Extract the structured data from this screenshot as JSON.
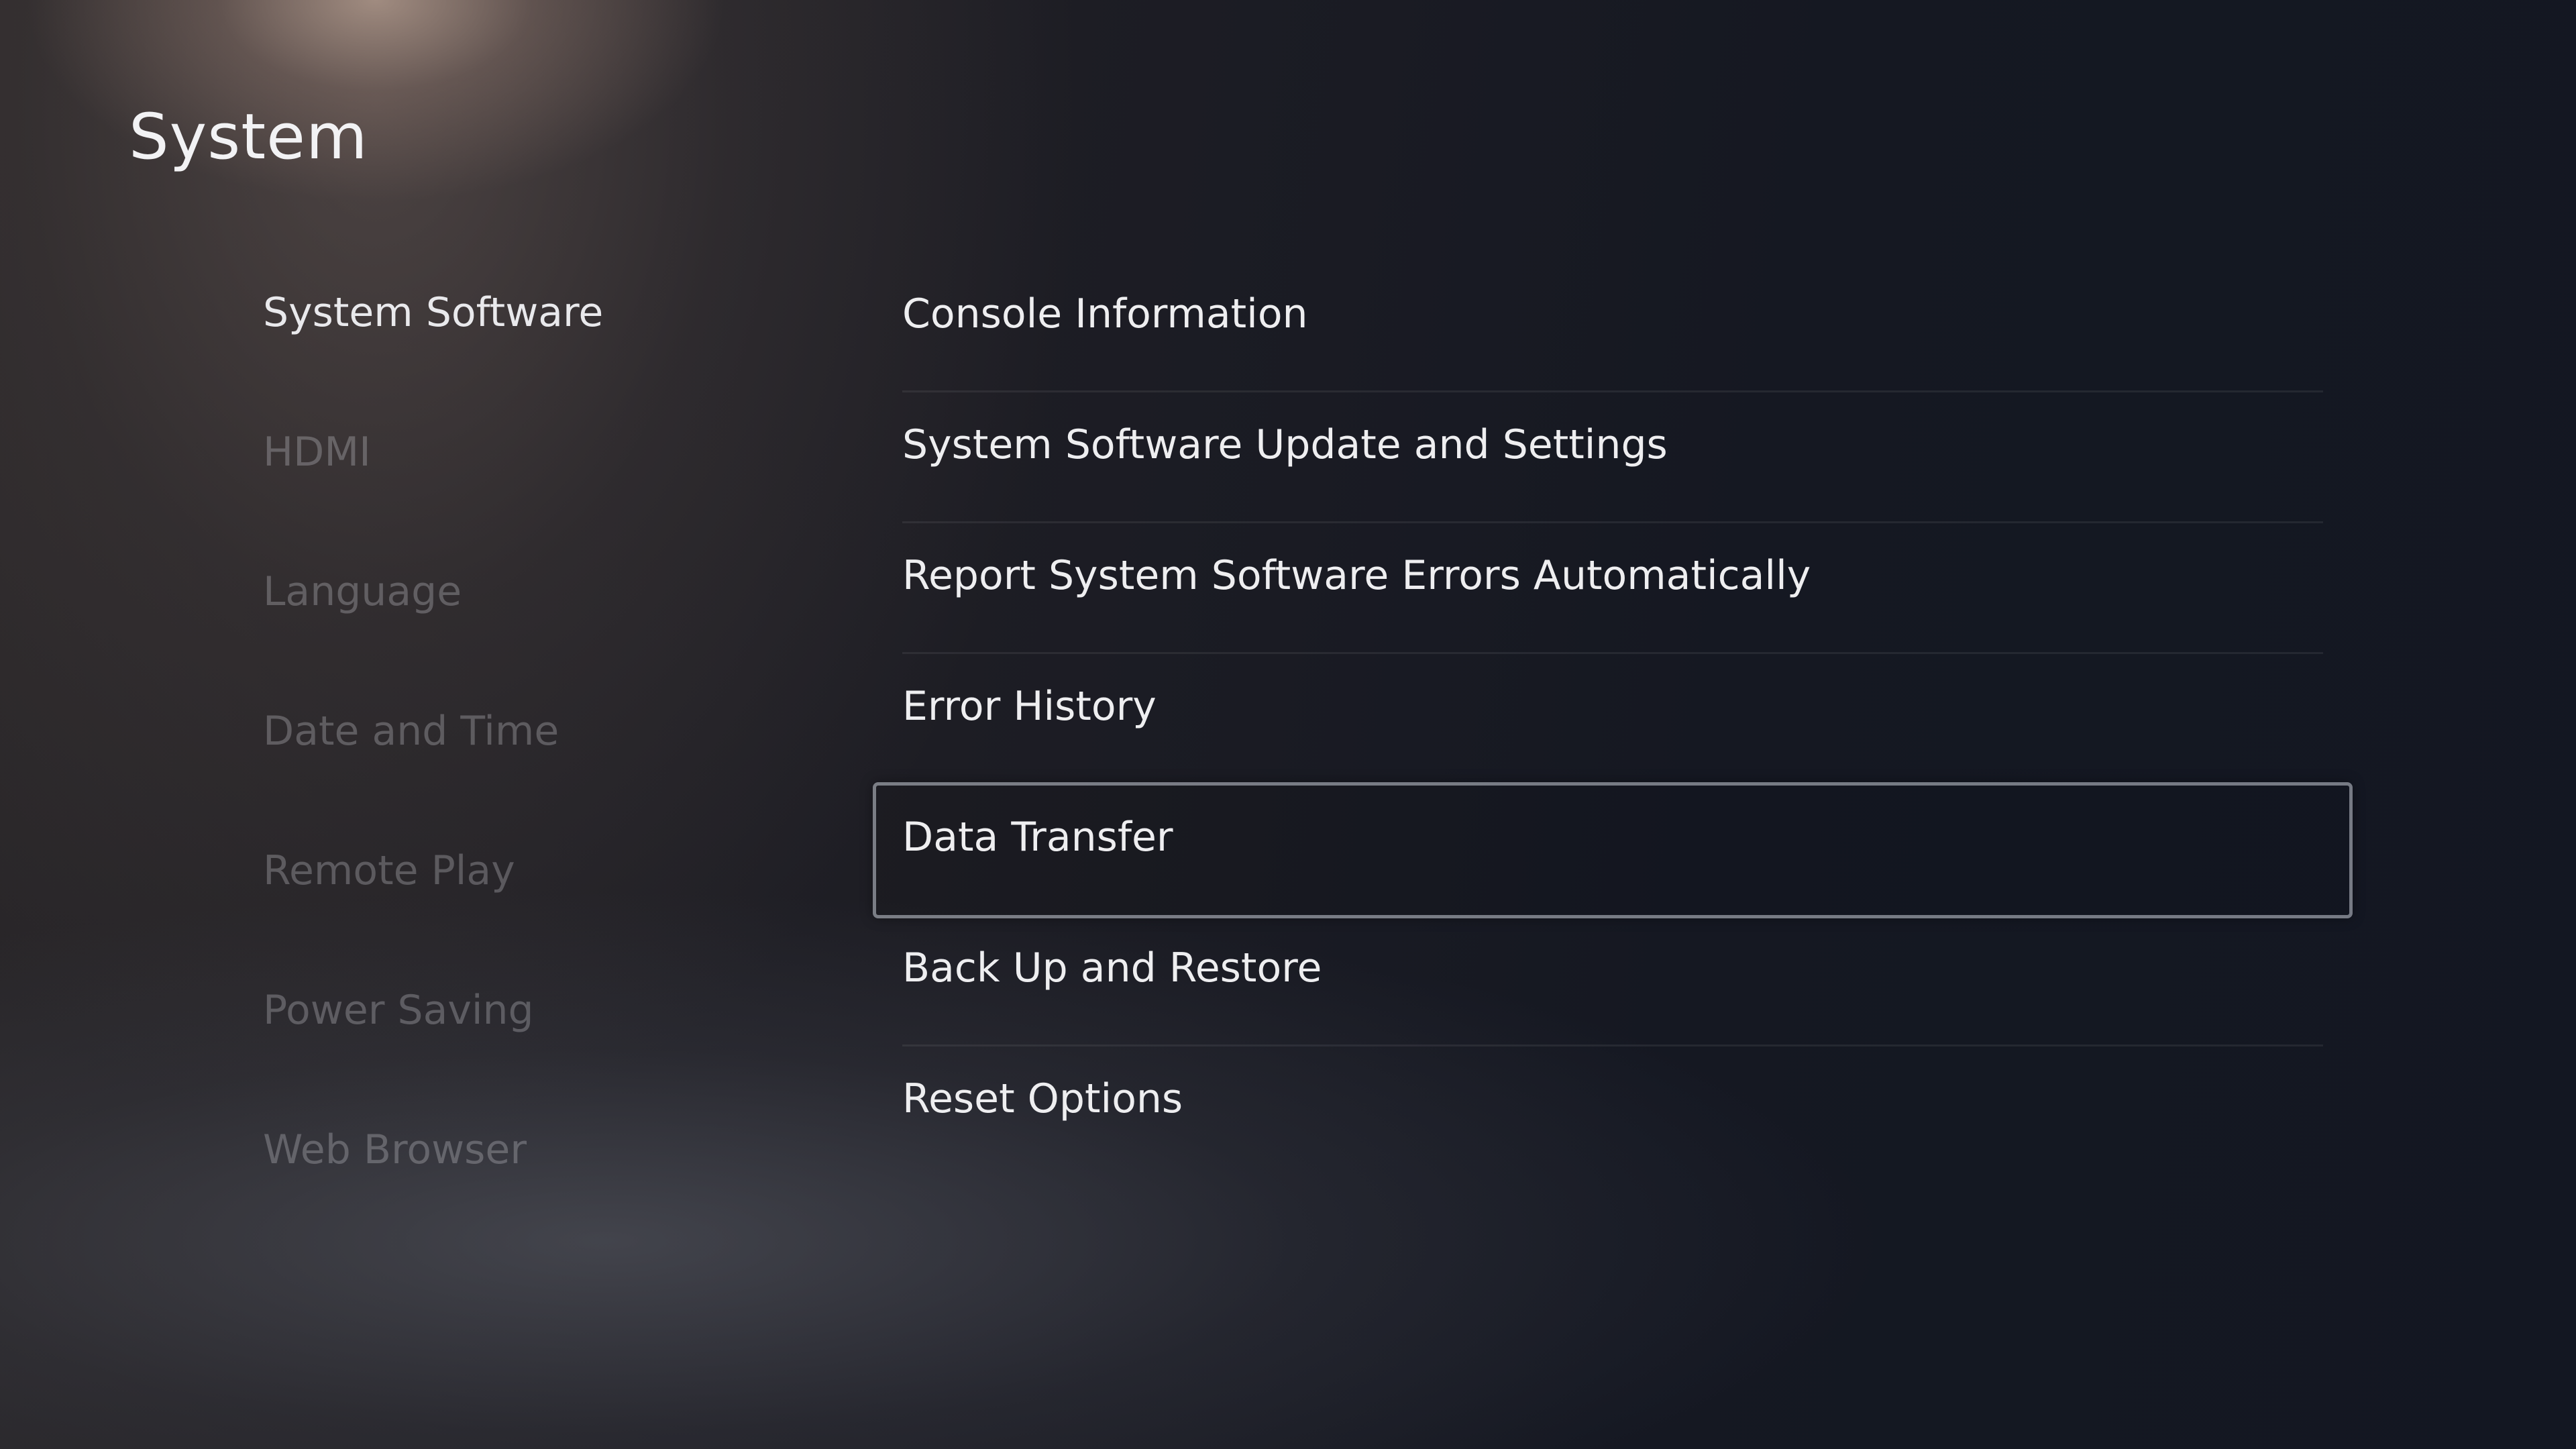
{
  "page": {
    "title": "System"
  },
  "sidebar": {
    "items": [
      {
        "label": "System Software",
        "active": true
      },
      {
        "label": "HDMI",
        "active": false
      },
      {
        "label": "Language",
        "active": false
      },
      {
        "label": "Date and Time",
        "active": false
      },
      {
        "label": "Remote Play",
        "active": false
      },
      {
        "label": "Power Saving",
        "active": false
      },
      {
        "label": "Web Browser",
        "active": false
      }
    ]
  },
  "main": {
    "items": [
      {
        "label": "Console Information"
      },
      {
        "label": "System Software Update and Settings"
      },
      {
        "label": "Report System Software Errors Automatically"
      },
      {
        "label": "Error History"
      },
      {
        "label": "Data Transfer",
        "focused": true
      },
      {
        "label": "Back Up and Restore"
      },
      {
        "label": "Reset Options"
      }
    ]
  },
  "colors": {
    "text_primary": "#eeeef0",
    "text_inactive": "#5b5b60",
    "background": "#151822",
    "focus_border": "#8c9099"
  }
}
